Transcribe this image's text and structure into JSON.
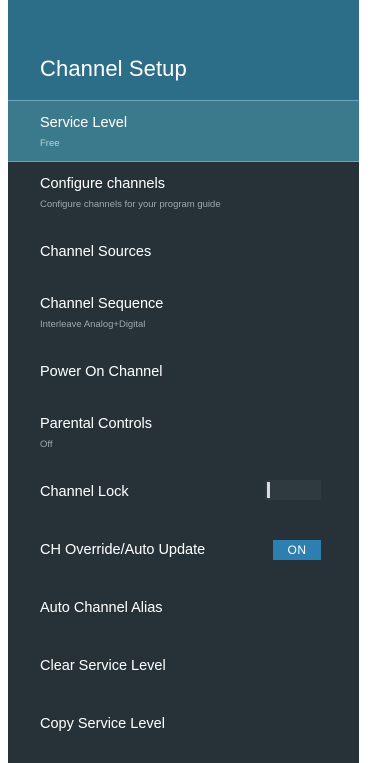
{
  "header": {
    "title": "Channel Setup"
  },
  "items": [
    {
      "label": "Service Level",
      "sub": "Free"
    },
    {
      "label": "Configure channels",
      "sub": "Configure channels for your program guide"
    },
    {
      "label": "Channel Sources"
    },
    {
      "label": "Channel Sequence",
      "sub": "Interleave Analog+Digital"
    },
    {
      "label": "Power On Channel"
    },
    {
      "label": "Parental Controls",
      "sub": "Off"
    },
    {
      "label": "Channel Lock",
      "toggle": "off"
    },
    {
      "label": "CH Override/Auto Update",
      "toggle_label": "ON"
    },
    {
      "label": "Auto Channel Alias"
    },
    {
      "label": "Clear Service Level"
    },
    {
      "label": "Copy Service Level"
    }
  ],
  "colors": {
    "header_bg": "#2c6e88",
    "panel_bg": "#263238",
    "selected_bg": "#3b7a8d",
    "toggle_on": "#2c7fb0"
  }
}
